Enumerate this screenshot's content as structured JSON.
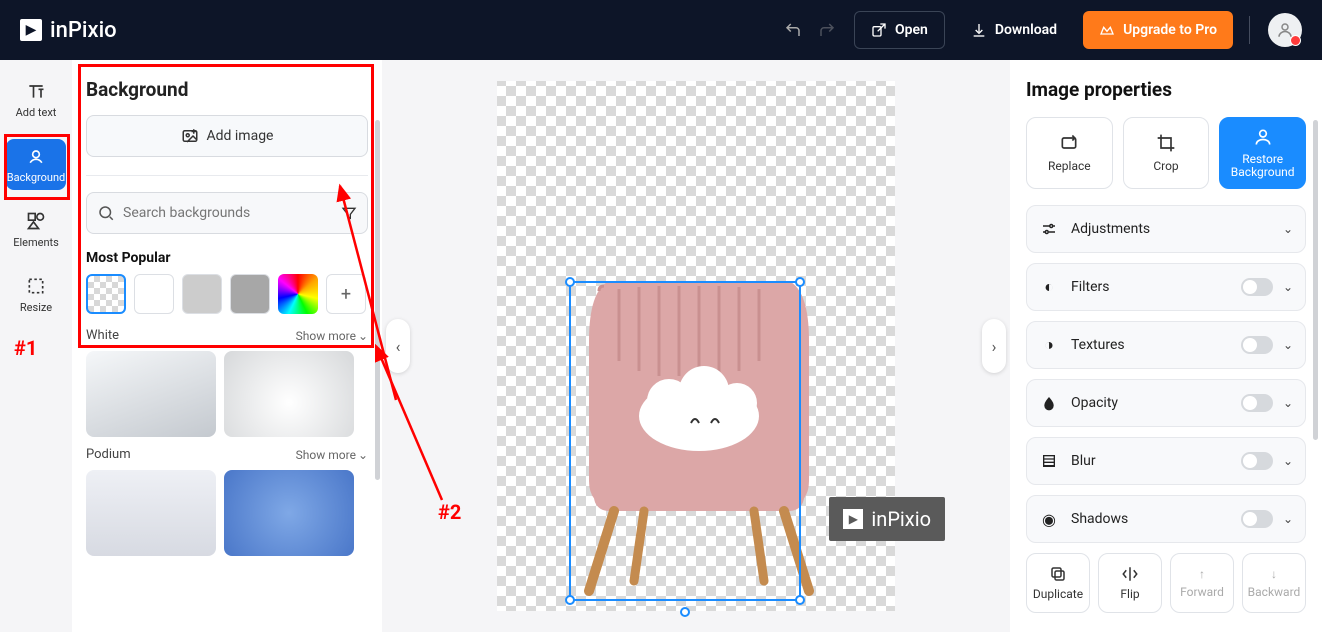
{
  "header": {
    "brand": "inPixio",
    "open": "Open",
    "download": "Download",
    "upgrade": "Upgrade to Pro"
  },
  "rail": {
    "add_text": "Add text",
    "background": "Background",
    "elements": "Elements",
    "resize": "Resize"
  },
  "panel": {
    "title": "Background",
    "add_image": "Add image",
    "search_placeholder": "Search backgrounds",
    "most_popular": "Most Popular",
    "white": "White",
    "podium": "Podium",
    "show_more": "Show more"
  },
  "annotations": {
    "one": "#1",
    "two": "#2"
  },
  "watermark": "inPixio",
  "props": {
    "title": "Image properties",
    "replace": "Replace",
    "crop": "Crop",
    "restore": "Restore Background",
    "adjustments": "Adjustments",
    "filters": "Filters",
    "textures": "Textures",
    "opacity": "Opacity",
    "blur": "Blur",
    "shadows": "Shadows",
    "duplicate": "Duplicate",
    "flip": "Flip",
    "forward": "Forward",
    "backward": "Backward"
  }
}
